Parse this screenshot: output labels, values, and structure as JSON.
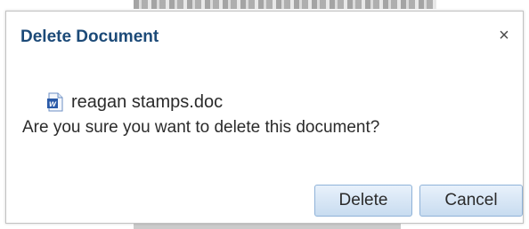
{
  "dialog": {
    "title": "Delete Document",
    "close_glyph": "×",
    "file": {
      "name": "reagan stamps.doc",
      "icon": "word-doc-icon"
    },
    "message": "Are you sure you want to delete this document?",
    "buttons": {
      "delete_label": "Delete",
      "cancel_label": "Cancel"
    }
  },
  "colors": {
    "title": "#1c4a78",
    "button_border": "#8fb2d8",
    "word_icon_blue": "#2a5aa8"
  }
}
